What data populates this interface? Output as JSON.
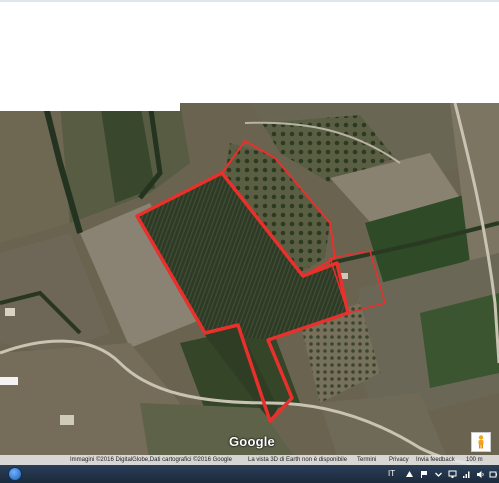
{
  "map": {
    "provider_logo": "Google",
    "attribution": {
      "imagery": "Immagini ©2016 DigitalGlobe,Dati cartografici ©2016 Google",
      "view_3d_notice": "La vista 3D di Earth non è disponibile",
      "terms": "Termini",
      "privacy": "Privacy",
      "feedback": "Invia feedback",
      "scale": "100 m"
    },
    "outline_color": "#e8302c"
  },
  "taskbar": {
    "language": "IT"
  }
}
